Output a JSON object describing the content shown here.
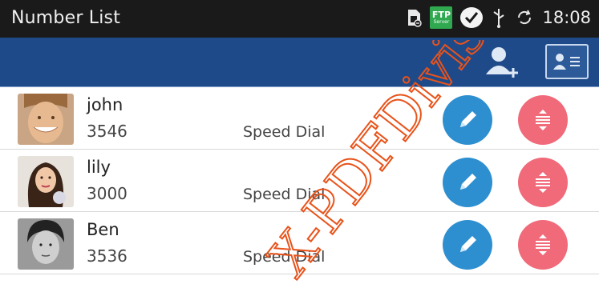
{
  "status_bar": {
    "title": "Number List",
    "ftp_top": "FTP",
    "ftp_bottom": "Server",
    "time": "18:08",
    "icons": [
      "sim-card-icon",
      "ftp-server-icon",
      "chat-icon",
      "usb-icon",
      "sync-icon"
    ]
  },
  "toolbar": {
    "icons": [
      "add-contact-icon",
      "contact-card-icon"
    ]
  },
  "contacts": [
    {
      "name": "john",
      "number": "3546",
      "speed_dial": "Speed Dial"
    },
    {
      "name": "lily",
      "number": "3000",
      "speed_dial": "Speed Dial"
    },
    {
      "name": "Ben",
      "number": "3536",
      "speed_dial": "Speed Dial"
    }
  ],
  "watermark": "X-PDFDivis",
  "colors": {
    "status_bar": "#1a1a1a",
    "toolbar": "#1e4a8a",
    "edit_button": "#2e8fd0",
    "delete_button": "#f06a7a",
    "watermark": "#e8531a"
  }
}
